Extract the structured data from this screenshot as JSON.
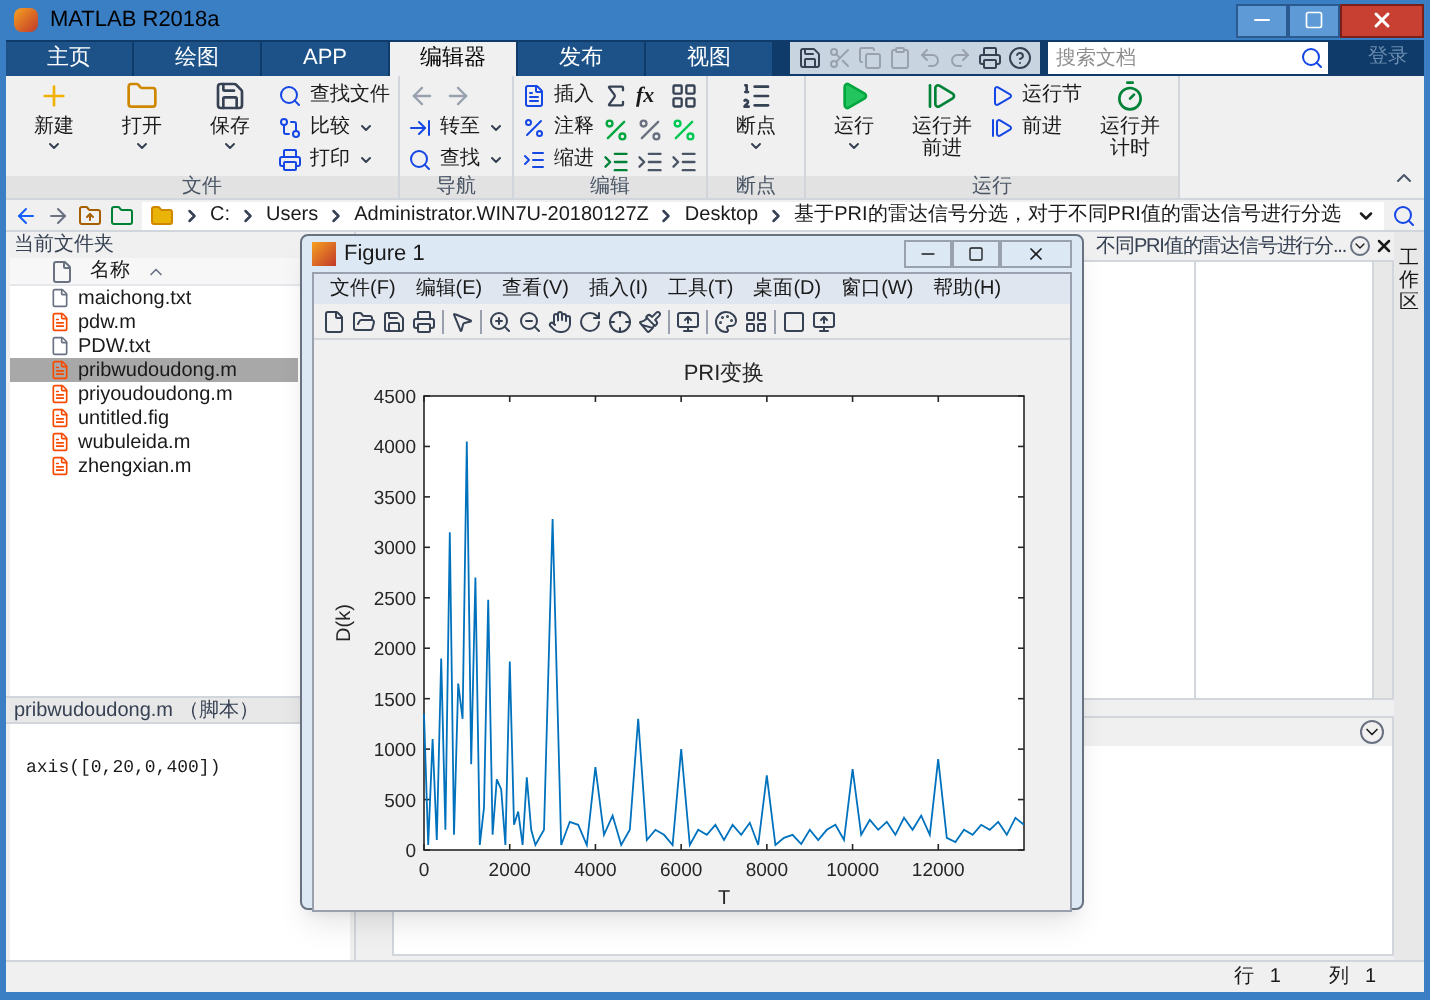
{
  "window": {
    "title": "MATLAB R2018a"
  },
  "tabs": [
    {
      "label": "主页",
      "selected": false
    },
    {
      "label": "绘图",
      "selected": false
    },
    {
      "label": "APP",
      "selected": false
    },
    {
      "label": "编辑器",
      "selected": true
    },
    {
      "label": "发布",
      "selected": false
    },
    {
      "label": "视图",
      "selected": false
    }
  ],
  "search": {
    "placeholder": "搜索文档"
  },
  "login": "登录",
  "ribbon": {
    "groups": [
      {
        "label": "文件",
        "columns": [
          {
            "kind": "large",
            "label": "新建",
            "dropdown": true
          },
          {
            "kind": "large",
            "label": "打开",
            "dropdown": true
          },
          {
            "kind": "large",
            "label": "保存",
            "dropdown": true
          },
          {
            "kind": "stack",
            "items": [
              {
                "label": "查找文件",
                "dropdown": false
              },
              {
                "label": "比较",
                "dropdown": true
              },
              {
                "label": "打印",
                "dropdown": true
              }
            ]
          }
        ]
      },
      {
        "label": "导航",
        "columns": [
          {
            "kind": "stack",
            "items": [
              {
                "kind": "arrows"
              },
              {
                "label": "转至",
                "dropdown": true
              },
              {
                "label": "查找",
                "dropdown": true
              }
            ]
          }
        ]
      },
      {
        "label": "编辑",
        "columns": [
          {
            "kind": "stack",
            "items": [
              {
                "label": "插入",
                "dropdown": false
              },
              {
                "label": "注释",
                "dropdown": false
              },
              {
                "label": "缩进",
                "dropdown": false
              }
            ]
          },
          {
            "kind": "icons",
            "label": "fx"
          }
        ]
      },
      {
        "label": "断点",
        "columns": [
          {
            "kind": "large",
            "label": "断点",
            "dropdown": true
          }
        ]
      },
      {
        "label": "运行",
        "columns": [
          {
            "kind": "large",
            "label": "运行",
            "dropdown": true
          },
          {
            "kind": "large",
            "label": "运行并前进",
            "dropdown": false
          },
          {
            "kind": "stack",
            "items": [
              {
                "label": "运行节",
                "dropdown": false
              },
              {
                "label": "前进",
                "dropdown": false
              }
            ]
          },
          {
            "kind": "large",
            "label": "运行并计时",
            "dropdown": false
          }
        ]
      }
    ]
  },
  "address": {
    "segments": [
      "C:",
      "Users",
      "Administrator.WIN7U-20180127Z",
      "Desktop",
      "基于PRI的雷达信号分选，对于不同PRI值的雷达信号进行分选"
    ]
  },
  "files": {
    "title": "当前文件夹",
    "column": "名称",
    "items": [
      {
        "name": "maichong.txt",
        "kind": "text",
        "selected": false
      },
      {
        "name": "pdw.m",
        "kind": "script",
        "selected": false
      },
      {
        "name": "PDW.txt",
        "kind": "text",
        "selected": false
      },
      {
        "name": "pribwudoudong.m",
        "kind": "script",
        "selected": true
      },
      {
        "name": "priyoudoudong.m",
        "kind": "script",
        "selected": false
      },
      {
        "name": "untitled.fig",
        "kind": "script",
        "selected": false
      },
      {
        "name": "wubuleida.m",
        "kind": "script",
        "selected": false
      },
      {
        "name": "zhengxian.m",
        "kind": "script",
        "selected": false
      }
    ]
  },
  "details": {
    "title": "pribwudoudong.m （脚本）",
    "content": "axis([0,20,0,400])"
  },
  "editor": {
    "tab": "不同PRI值的雷达信号进行分..."
  },
  "side_tab": "工作区",
  "status_bar": {
    "row_label": "行",
    "row": "1",
    "col_label": "列",
    "col": "1"
  },
  "figure": {
    "title": "Figure 1",
    "menus": [
      "文件(F)",
      "编辑(E)",
      "查看(V)",
      "插入(I)",
      "工具(T)",
      "桌面(D)",
      "窗口(W)",
      "帮助(H)"
    ],
    "chart_data": {
      "type": "line",
      "title": "PRI变换",
      "xlabel": "T",
      "ylabel": "D(k)",
      "xlim": [
        0,
        14000
      ],
      "ylim": [
        0,
        4500
      ],
      "xticks": [
        0,
        2000,
        4000,
        6000,
        8000,
        10000,
        12000
      ],
      "yticks": [
        0,
        500,
        1000,
        1500,
        2000,
        2500,
        3000,
        3500,
        4000,
        4500
      ],
      "x": [
        0,
        100,
        200,
        300,
        400,
        500,
        600,
        700,
        800,
        900,
        1000,
        1100,
        1200,
        1300,
        1400,
        1500,
        1600,
        1700,
        1800,
        1900,
        2000,
        2100,
        2200,
        2300,
        2400,
        2500,
        2600,
        2800,
        3000,
        3200,
        3400,
        3600,
        3800,
        4000,
        4200,
        4400,
        4600,
        4800,
        5000,
        5200,
        5400,
        5600,
        5800,
        6000,
        6200,
        6400,
        6600,
        6800,
        7000,
        7200,
        7400,
        7600,
        7800,
        8000,
        8200,
        8400,
        8600,
        8800,
        9000,
        9200,
        9400,
        9600,
        9800,
        10000,
        10200,
        10400,
        10600,
        10800,
        11000,
        11200,
        11400,
        11600,
        11800,
        12000,
        12200,
        12400,
        12600,
        12800,
        13000,
        13200,
        13400,
        13600,
        13800,
        14000
      ],
      "series": [
        {
          "color": "#0072bd",
          "values": [
            1350,
            50,
            1100,
            100,
            1900,
            200,
            3150,
            150,
            1650,
            1300,
            4050,
            850,
            2700,
            50,
            420,
            2480,
            150,
            700,
            600,
            50,
            1870,
            250,
            380,
            50,
            720,
            200,
            50,
            200,
            3280,
            50,
            280,
            250,
            50,
            820,
            150,
            340,
            50,
            200,
            1300,
            100,
            200,
            150,
            50,
            1000,
            50,
            200,
            150,
            250,
            100,
            250,
            150,
            270,
            50,
            740,
            50,
            120,
            150,
            60,
            200,
            100,
            200,
            250,
            100,
            800,
            150,
            300,
            200,
            280,
            150,
            320,
            200,
            340,
            150,
            900,
            120,
            80,
            200,
            150,
            250,
            200,
            280,
            150,
            320,
            250
          ]
        }
      ]
    }
  }
}
